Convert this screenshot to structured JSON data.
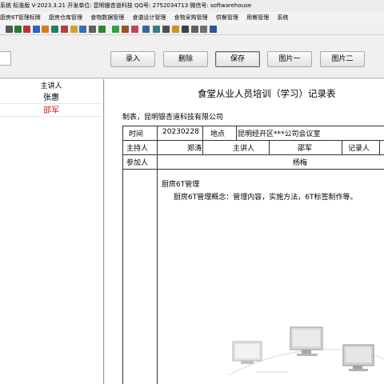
{
  "window": {
    "title": "系统 标准版 V-2023.3.21 开发单位: 昆明银杏道科技  QQ号: 2752034713  微信号: softwarehouse"
  },
  "menu": [
    "厨房6T管理标牌",
    "厨房仓库管理",
    "食物数据管理",
    "食谱设计管理",
    "食物采购管理",
    "供餐管理",
    "用餐管理",
    "系统"
  ],
  "toolbar_icons": [
    {
      "name": "cut-icon",
      "color": "#555555"
    },
    {
      "name": "link-icon",
      "color": "#2a7a2a"
    },
    {
      "name": "tools-icon",
      "color": "#c03030"
    },
    {
      "name": "sync-icon",
      "color": "#3060c0"
    },
    {
      "name": "edit-icon",
      "color": "#d08020"
    },
    {
      "name": "list-icon",
      "color": "#208060"
    },
    {
      "name": "chart-icon",
      "color": "#b04040"
    },
    {
      "name": "folder-icon",
      "color": "#d0a030"
    },
    {
      "name": "users-icon",
      "color": "#3070b0"
    },
    {
      "name": "print-icon",
      "color": "#606060"
    },
    {
      "name": "calendar-icon",
      "color": "#2a8a2a"
    },
    {
      "name": "tree-icon",
      "color": "#30a040"
    },
    {
      "name": "cart-icon",
      "color": "#a05020"
    },
    {
      "name": "food-icon",
      "color": "#c04060"
    },
    {
      "name": "form-icon",
      "color": "#4060a0"
    },
    {
      "name": "table-icon",
      "color": "#308080"
    },
    {
      "name": "grid-icon",
      "color": "#505050"
    },
    {
      "name": "star-icon",
      "color": "#d09020"
    },
    {
      "name": "camera-icon",
      "color": "#404040"
    },
    {
      "name": "trash-icon",
      "color": "#606060"
    },
    {
      "name": "paste-icon",
      "color": "#707070"
    },
    {
      "name": "exit-icon",
      "color": "#3050a0"
    }
  ],
  "actions": {
    "add": "录入",
    "delete": "删除",
    "save": "保存",
    "pic1": "图片一",
    "pic2": "图片二"
  },
  "list": {
    "header": "主讲人",
    "rows": [
      {
        "name": "张惠",
        "color": "#000000"
      },
      {
        "name": "邵军",
        "color": "#d02020"
      }
    ]
  },
  "document": {
    "title": "食堂从业人员培训（学习）记录表",
    "maker": "制表，昆明银杏道科技有限公司",
    "table": {
      "time_label": "时间",
      "time_value": "20230228",
      "place_label": "地点",
      "place_value": "昆明经开区***公司会议室",
      "host_label": "主持人",
      "host_value": "郑涛",
      "speaker_label": "主讲人",
      "speaker_value": "邵军",
      "recorder_label": "记录人",
      "attendee_label": "参加人",
      "attendee_value": "杨梅"
    },
    "content_title": "厨房6T管理",
    "content_body": "厨房6T管理概念：管理内容，实施方法，6T标签制作等。"
  }
}
